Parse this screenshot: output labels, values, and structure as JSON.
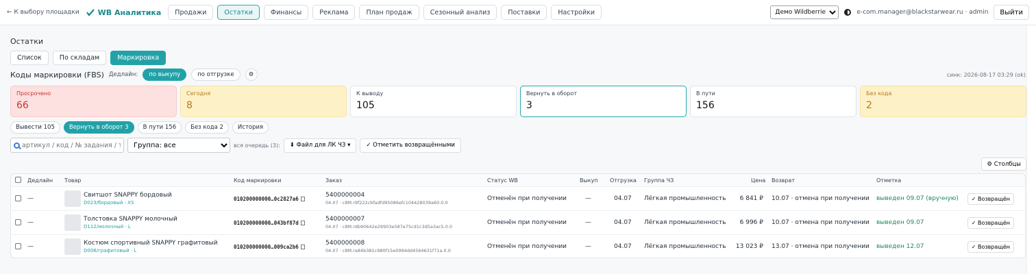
{
  "topbar": {
    "back": "← К выбору площадки",
    "brand": "WB Аналитика",
    "tabs": [
      "Продажи",
      "Остатки",
      "Финансы",
      "Реклама",
      "План продаж",
      "Сезонный анализ",
      "Поставки",
      "Настройки"
    ],
    "active_tab": "Остатки",
    "marketplace_select": "Демо Wildberries",
    "user": "e-com.manager@blackstarwear.ru · admin",
    "logout": "Выйти"
  },
  "page": {
    "title": "Остатки",
    "view_tabs": [
      "Список",
      "По складам",
      "Маркировка"
    ],
    "active_view": "Маркировка",
    "section_title": "Коды маркировки (FBS)",
    "deadline_label": "Дедлайн:",
    "deadline_options": [
      "по выкупу",
      "по отгрузке"
    ],
    "deadline_round": "⚙",
    "sync": "синк: 2026-08-17 03:29 (ok)"
  },
  "cards": [
    {
      "label": "Просрочено",
      "value": "66",
      "tone": "red"
    },
    {
      "label": "Сегодня",
      "value": "8",
      "tone": "yellow"
    },
    {
      "label": "К выводу",
      "value": "105",
      "tone": "plain"
    },
    {
      "label": "Вернуть в оборот",
      "value": "3",
      "tone": "selected"
    },
    {
      "label": "В пути",
      "value": "156",
      "tone": "plain"
    },
    {
      "label": "Без кода",
      "value": "2",
      "tone": "yellow"
    }
  ],
  "chips": [
    "Вывести 105",
    "Вернуть в оборот 3",
    "В пути 156",
    "Без кода 2",
    "История"
  ],
  "active_chip": "Вернуть в оборот 3",
  "filters": {
    "search_placeholder": "артикул / код / № задания / т",
    "group_select": "Группа: все",
    "queue": "вся очередь (3):",
    "file_button": "⬇ Файл для ЛК ЧЗ ▾",
    "mark_returned_button": "✓ Отметить возвращёнными",
    "columns_button": "⚙ Столбцы"
  },
  "table": {
    "headers": [
      "Дедлайн",
      "Товар",
      "Код маркировки",
      "Заказ",
      "Статус WB",
      "Выкуп",
      "Отгрузка",
      "Группа ЧЗ",
      "Цена",
      "Возврат",
      "Отметка"
    ],
    "rows": [
      {
        "deadline": "—",
        "name": "Свитшот SNAPPY бордовый",
        "sku": "D023/бордовый · XS",
        "code": "010200000000…0c2827a6",
        "order": "5400000004",
        "order_sub": "04.07 · c8M.r9f222cbfadfd95086efc104428039a60.0.0",
        "status": "Отменён при получении",
        "buyout": "—",
        "ship": "04.07",
        "group": "Лёгкая промышленность",
        "price": "6 841 ₽",
        "return": "10.07 · отмена при получении",
        "mark": "выведен 09.07 (вручную)",
        "action": "✓ Возвращён"
      },
      {
        "deadline": "—",
        "name": "Толстовка SNAPPY молочный",
        "sku": "D112/молочный · L",
        "code": "010200000000…043bf87d",
        "order": "5400000007",
        "order_sub": "04.07 · c8M.rdb90642e29903e587e75cd1c3d5a3ac5.0.0",
        "status": "Отменён при получении",
        "buyout": "—",
        "ship": "04.07",
        "group": "Лёгкая промышленность",
        "price": "6 996 ₽",
        "return": "10.07 · отмена при получении",
        "mark": "выведен 09.07",
        "action": "✓ Возвращён"
      },
      {
        "deadline": "—",
        "name": "Костюм спортивный SNAPPY графитовый",
        "sku": "D008/графитовый · L",
        "code": "010200000000…009ca2b6",
        "order": "5400000008",
        "order_sub": "04.07 · c8M.ra84b381c980f15e0994dd4564631f71a.0.0",
        "status": "Отменён при получении",
        "buyout": "—",
        "ship": "04.07",
        "group": "Лёгкая промышленность",
        "price": "13 023 ₽",
        "return": "13.07 · отмена при получении",
        "mark": "выведен 12.07",
        "action": "✓ Возвращён"
      }
    ]
  }
}
